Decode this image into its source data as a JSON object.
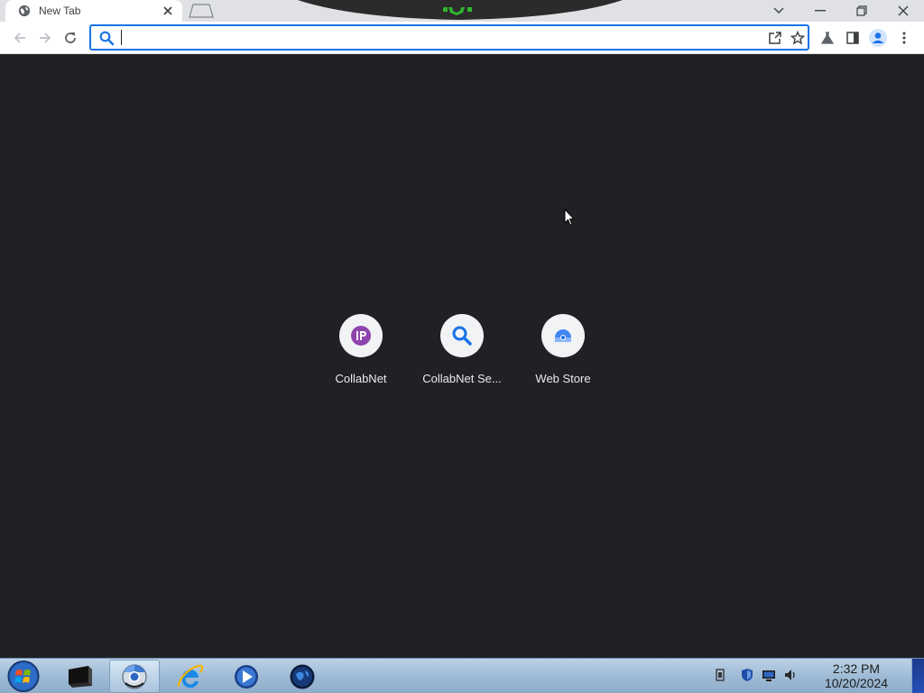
{
  "browser": {
    "tab": {
      "title": "New Tab"
    },
    "omnibox": {
      "value": "",
      "placeholder": ""
    }
  },
  "new_tab_page": {
    "shortcuts": [
      {
        "label": "CollabNet",
        "icon": "collabnet-ip-icon",
        "color": "#8e44ad"
      },
      {
        "label": "CollabNet Se...",
        "icon": "magnifier-icon",
        "color": "#1a73e8"
      },
      {
        "label": "Web Store",
        "icon": "web-store-icon",
        "color": "#4285f4"
      }
    ]
  },
  "taskbar": {
    "apps": [
      "terminal-app",
      "chrome-app",
      "internet-explorer-app",
      "media-player-app",
      "network-globe-app"
    ],
    "active_app": "chrome-app",
    "clock": {
      "time": "2:32 PM",
      "date": "10/20/2024"
    }
  },
  "colors": {
    "accent": "#1a73e8",
    "page_background": "#202124",
    "tab_strip": "#dfe1e5"
  }
}
